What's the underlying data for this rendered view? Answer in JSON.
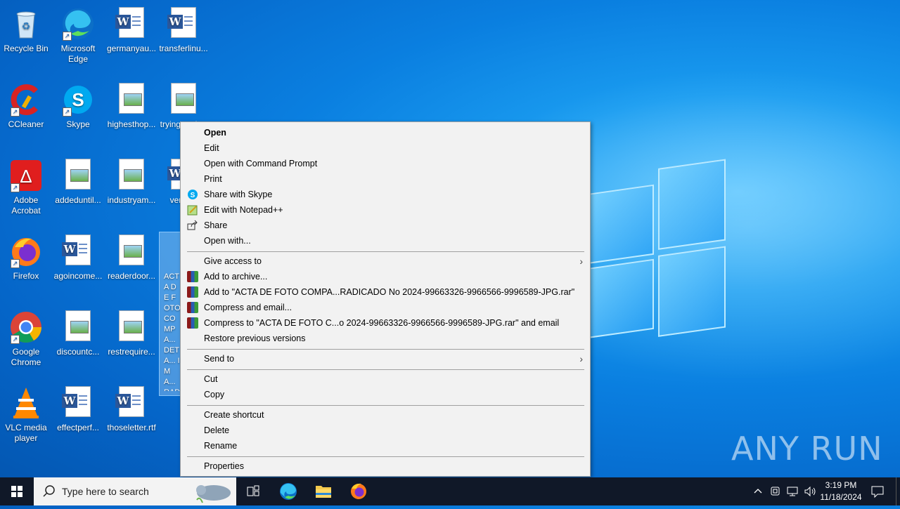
{
  "desktop": {
    "icons": [
      {
        "label": "Recycle Bin",
        "icon": "recycle-bin-icon"
      },
      {
        "label": "Microsoft Edge",
        "icon": "edge-icon"
      },
      {
        "label": "germanyau...",
        "icon": "word-doc-icon"
      },
      {
        "label": "transferlinu...",
        "icon": "word-doc-icon"
      },
      {
        "label": "CCleaner",
        "icon": "ccleaner-icon"
      },
      {
        "label": "Skype",
        "icon": "skype-icon"
      },
      {
        "label": "highesthop...",
        "icon": "image-file-icon"
      },
      {
        "label": "tryingearth...",
        "icon": "image-file-icon"
      },
      {
        "label": "Adobe Acrobat",
        "icon": "acrobat-icon"
      },
      {
        "label": "addeduntil...",
        "icon": "image-file-icon"
      },
      {
        "label": "industryam...",
        "icon": "image-file-icon"
      },
      {
        "label": "verys...",
        "icon": "word-doc-icon"
      },
      {
        "label": "Firefox",
        "icon": "firefox-icon"
      },
      {
        "label": "agoincome...",
        "icon": "word-doc-icon"
      },
      {
        "label": "readerdoor...",
        "icon": "image-file-icon"
      },
      {
        "label": "Google Chrome",
        "icon": "chrome-icon"
      },
      {
        "label": "discountc...",
        "icon": "image-file-icon"
      },
      {
        "label": "restrequire...",
        "icon": "image-file-icon"
      },
      {
        "label": "VLC media player",
        "icon": "vlc-icon"
      },
      {
        "label": "effectperf...",
        "icon": "word-doc-icon"
      },
      {
        "label": "thoseletter.rtf",
        "icon": "word-doc-icon"
      }
    ],
    "selected_file_label": "ACTA DE FOTO COMPA... DETA... IMA... RADICADO No 2024-99663326-9966566-9996589"
  },
  "context_menu": {
    "items": [
      {
        "label": "Open",
        "bold": true
      },
      {
        "label": "Edit"
      },
      {
        "label": "Open with Command Prompt"
      },
      {
        "label": "Print"
      },
      {
        "label": "Share with Skype",
        "icon": "skype-icon"
      },
      {
        "label": "Edit with Notepad++",
        "icon": "notepad-plus-icon"
      },
      {
        "label": "Share",
        "icon": "share-icon"
      },
      {
        "label": "Open with..."
      },
      {
        "label": "Give access to",
        "submenu": true
      },
      {
        "label": "Add to archive...",
        "icon": "winrar-icon"
      },
      {
        "label": "Add to \"ACTA DE FOTO COMPA...RADICADO No 2024-99663326-9966566-9996589-JPG.rar\"",
        "icon": "winrar-icon"
      },
      {
        "label": "Compress and email...",
        "icon": "winrar-icon"
      },
      {
        "label": "Compress to \"ACTA DE FOTO C...o 2024-99663326-9966566-9996589-JPG.rar\" and email",
        "icon": "winrar-icon"
      },
      {
        "label": "Restore previous versions"
      },
      {
        "label": "Send to",
        "submenu": true
      },
      {
        "label": "Cut"
      },
      {
        "label": "Copy"
      },
      {
        "label": "Create shortcut"
      },
      {
        "label": "Delete"
      },
      {
        "label": "Rename"
      },
      {
        "label": "Properties"
      }
    ]
  },
  "watermark": "ANY RUN",
  "taskbar": {
    "search_placeholder": "Type here to search",
    "pinned": [
      "task-view-icon",
      "edge-icon",
      "file-explorer-icon",
      "firefox-icon"
    ],
    "time": "3:19 PM",
    "date": "11/18/2024"
  },
  "colors": {
    "menu_bg": "#f2f2f2",
    "taskbar_bg": "#101828",
    "accent": "#0078d7"
  }
}
